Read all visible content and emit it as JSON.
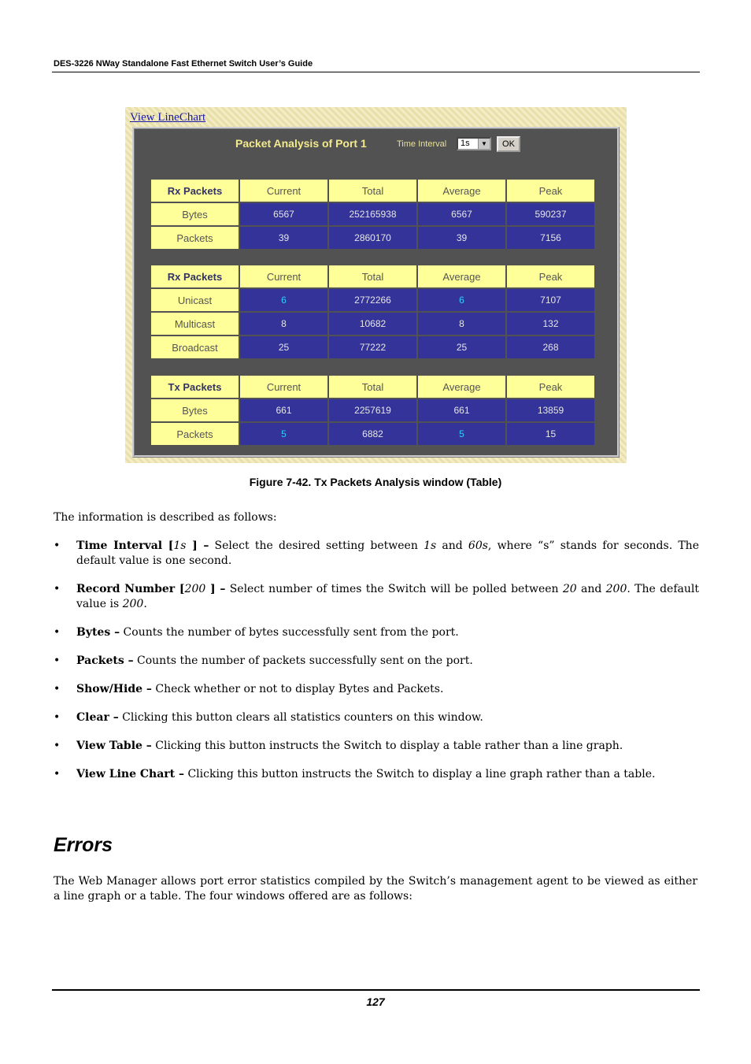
{
  "header": {
    "title": "DES-3226 NWay Standalone Fast Ethernet Switch User’s Guide"
  },
  "screenshot": {
    "link": "View LineChart",
    "panel_title": "Packet Analysis of Port 1",
    "time_interval_label": "Time Interval",
    "time_interval_value": "1s",
    "ok_label": "OK",
    "columns": [
      "Current",
      "Total",
      "Average",
      "Peak"
    ],
    "tables": [
      {
        "title": "Rx Packets",
        "rows": [
          {
            "label": "Bytes",
            "values": [
              "6567",
              "252165938",
              "6567",
              "590237"
            ]
          },
          {
            "label": "Packets",
            "values": [
              "39",
              "2860170",
              "39",
              "7156"
            ]
          }
        ]
      },
      {
        "title": "Rx Packets",
        "rows": [
          {
            "label": "Unicast",
            "values": [
              "6",
              "2772266",
              "6",
              "7107"
            ]
          },
          {
            "label": "Multicast",
            "values": [
              "8",
              "10682",
              "8",
              "132"
            ]
          },
          {
            "label": "Broadcast",
            "values": [
              "25",
              "77222",
              "25",
              "268"
            ]
          }
        ]
      },
      {
        "title": "Tx Packets",
        "rows": [
          {
            "label": "Bytes",
            "values": [
              "661",
              "2257619",
              "661",
              "13859"
            ]
          },
          {
            "label": "Packets",
            "values": [
              "5",
              "6882",
              "5",
              "15"
            ]
          }
        ]
      }
    ]
  },
  "caption": "Figure 7-42.  Tx Packets Analysis window (Table)",
  "intro": "The information is described as follows:",
  "bullets": [
    {
      "term": "Time Interval [",
      "param": "1s",
      "term_end": " ] –",
      "text_html": " Select the desired setting between <i>1s</i> and <i>60s</i>, where “s” stands for seconds. The default value is one second."
    },
    {
      "term": "Record Number [",
      "param": "200",
      "term_end": " ] –",
      "text_html": " Select number of times the Switch will be polled between <i>20</i> and <i>200</i>. The default value is <i>200</i>."
    },
    {
      "term": "Bytes –",
      "param": "",
      "term_end": "",
      "text_html": " Counts the number of bytes successfully sent from the port."
    },
    {
      "term": "Packets –",
      "param": "",
      "term_end": "",
      "text_html": " Counts the number of packets successfully sent on the port."
    },
    {
      "term": "Show/Hide –",
      "param": "",
      "term_end": "",
      "text_html": " Check whether or not to display Bytes and Packets."
    },
    {
      "term": "Clear –",
      "param": "",
      "term_end": "",
      "text_html": " Clicking this button clears all statistics counters on this window."
    },
    {
      "term": "View Table –",
      "param": "",
      "term_end": "",
      "text_html": " Clicking this button instructs the Switch to display a table rather than a line graph."
    },
    {
      "term": "View Line Chart –",
      "param": "",
      "term_end": "",
      "text_html": " Clicking this button instructs the Switch to display a line graph rather than a table."
    }
  ],
  "section_heading": "Errors",
  "section_para": "The Web Manager allows port error statistics compiled by the Switch’s management agent to be viewed as either a line graph or a table. The four windows offered are as follows:",
  "page_number": "127",
  "colors": {
    "header_cell": "#ffff99",
    "value_cell": "#333399",
    "highlight_value": "#33ccff",
    "panel": "#525252"
  }
}
